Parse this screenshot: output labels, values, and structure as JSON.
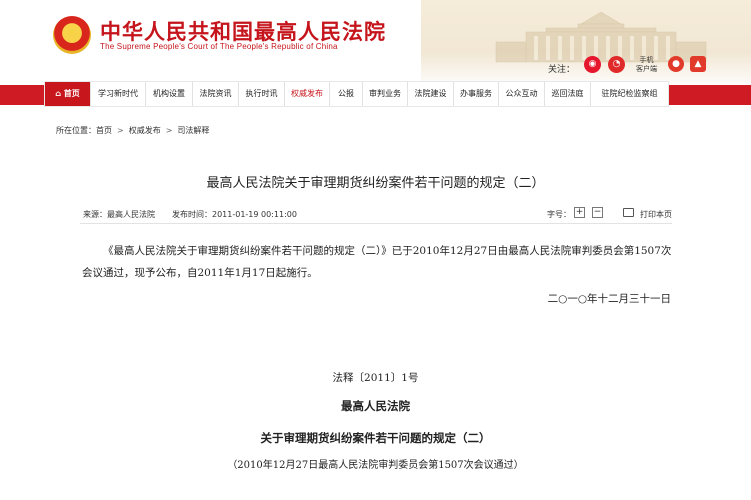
{
  "header": {
    "title": "中华人民共和国最高人民法院",
    "subtitle": "The Supreme People's Court of The People's Republic of China",
    "follow_label": "关注：",
    "mobile_label_line1": "手机",
    "mobile_label_line2": "客户端"
  },
  "nav": {
    "items": [
      {
        "label": "首页"
      },
      {
        "label": "学习新时代"
      },
      {
        "label": "机构设置"
      },
      {
        "label": "法院资讯"
      },
      {
        "label": "执行时讯"
      },
      {
        "label": "权威发布"
      },
      {
        "label": "公报"
      },
      {
        "label": "审判业务"
      },
      {
        "label": "法院建设"
      },
      {
        "label": "办事服务"
      },
      {
        "label": "公众互动"
      },
      {
        "label": "巡回法庭"
      },
      {
        "label": "驻院纪检监察组"
      }
    ]
  },
  "breadcrumb": {
    "prefix": "所在位置：",
    "items": [
      "首页",
      "权威发布",
      "司法解释"
    ],
    "separator": ">"
  },
  "article": {
    "title": "最高人民法院关于审理期货纠纷案件若干问题的规定（二）",
    "source": "来源：最高人民法院",
    "publish_time": "发布时间：2011-01-19 00:11:00",
    "font_size_label": "字号：",
    "font_plus": "+",
    "font_minus": "−",
    "print_label": "打印本页",
    "paragraph_1": "《最高人民法院关于审理期货纠纷案件若干问题的规定（二）》已于2010年12月27日由最高人民法院审判委员会第1507次会议通过，现予公布，自2011年1月17日起施行。",
    "date": "二○一○年十二月三十一日",
    "doc_number": "法释〔2011〕1号",
    "court_name": "最高人民法院",
    "regulation_title": "关于审理期货纠纷案件若干问题的规定（二）",
    "adoption_note": "（2010年12月27日最高人民法院审判委员会第1507次会议通过）"
  },
  "colors": {
    "brand_red": "#c5141b",
    "nav_bar": "#cf1b23"
  }
}
